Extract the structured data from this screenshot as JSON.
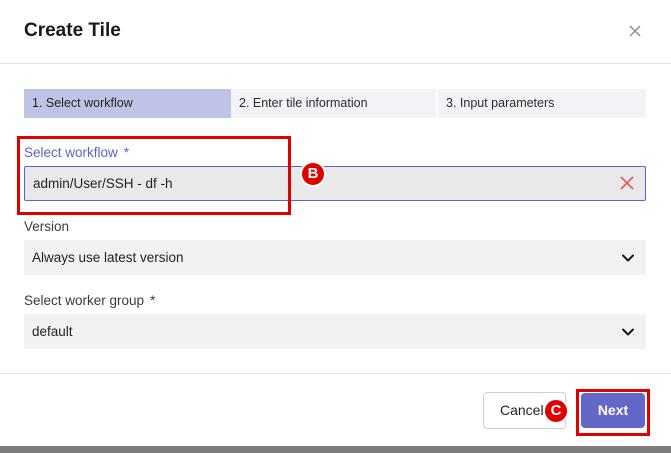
{
  "dialog": {
    "title": "Create Tile",
    "close_icon": "close-icon"
  },
  "stepper": {
    "steps": [
      {
        "label": "1. Select workflow",
        "active": true
      },
      {
        "label": "2. Enter tile information",
        "active": false
      },
      {
        "label": "3. Input parameters",
        "active": false
      }
    ]
  },
  "form": {
    "workflow": {
      "label": "Select workflow",
      "required_mark": "*",
      "value": "admin/User/SSH - df -h",
      "clear_icon": "clear-x-icon"
    },
    "version": {
      "label": "Version",
      "value": "Always use latest version",
      "icon": "chevron-down-icon"
    },
    "worker_group": {
      "label": "Select worker group",
      "required_mark": "*",
      "value": "default",
      "icon": "chevron-down-icon"
    }
  },
  "footer": {
    "cancel_label": "Cancel",
    "next_label": "Next"
  },
  "annotations": {
    "badge_b": "B",
    "badge_c": "C",
    "highlight_color": "#e00000"
  },
  "colors": {
    "accent": "#5b63c8",
    "next_button": "#6467c8",
    "active_step": "#bfc4e6",
    "clear_icon": "#e05a5a"
  }
}
